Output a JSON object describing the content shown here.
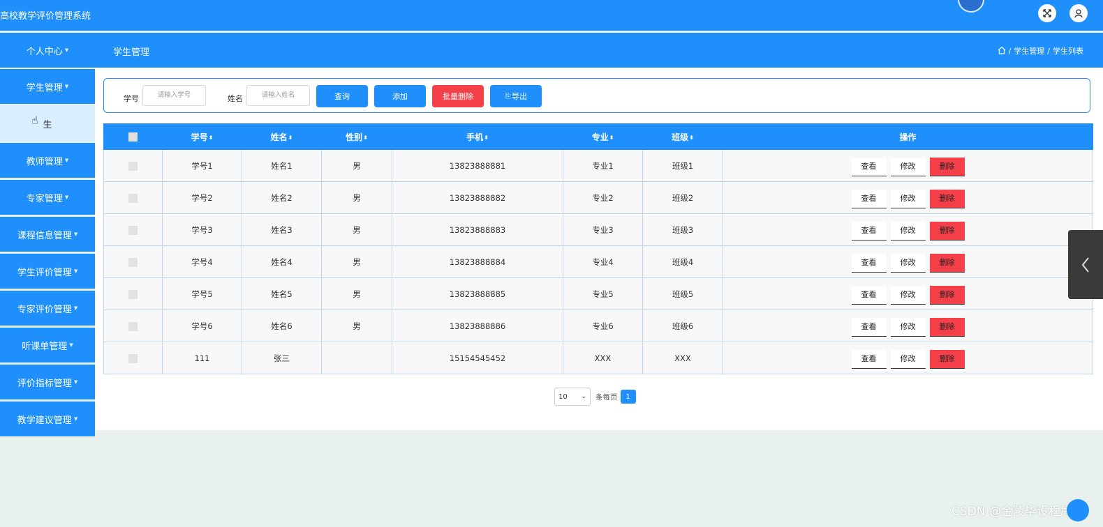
{
  "app": {
    "title": "高校教学评价管理系统"
  },
  "header_icons": [
    "fullscreen-icon",
    "user-icon"
  ],
  "subbar": {
    "title": "学生管理",
    "breadcrumb": [
      "学生管理",
      "学生列表"
    ]
  },
  "sidebar": {
    "items": [
      {
        "label": "个人中心"
      },
      {
        "label": "学生管理"
      },
      {
        "label": "教师管理"
      },
      {
        "label": "专家管理"
      },
      {
        "label": "课程信息管理"
      },
      {
        "label": "学生评价管理"
      },
      {
        "label": "专家评价管理"
      },
      {
        "label": "听课单管理"
      },
      {
        "label": "评价指标管理"
      },
      {
        "label": "教学建议管理"
      }
    ],
    "active_sub": "生"
  },
  "search": {
    "student_no_label": "学号",
    "student_no_placeholder": "请输入学号",
    "name_label": "姓名",
    "name_placeholder": "请输入姓名",
    "query_btn": "查询",
    "add_btn": "添加",
    "batch_delete_btn": "批量删除",
    "export_btn": "导出"
  },
  "table": {
    "columns": [
      "学号",
      "姓名",
      "性别",
      "手机",
      "专业",
      "班级",
      "操作"
    ],
    "rows": [
      {
        "no": "学号1",
        "name": "姓名1",
        "gender": "男",
        "phone": "13823888881",
        "major": "专业1",
        "class": "班级1"
      },
      {
        "no": "学号2",
        "name": "姓名2",
        "gender": "男",
        "phone": "13823888882",
        "major": "专业2",
        "class": "班级2"
      },
      {
        "no": "学号3",
        "name": "姓名3",
        "gender": "男",
        "phone": "13823888883",
        "major": "专业3",
        "class": "班级3"
      },
      {
        "no": "学号4",
        "name": "姓名4",
        "gender": "男",
        "phone": "13823888884",
        "major": "专业4",
        "class": "班级4"
      },
      {
        "no": "学号5",
        "name": "姓名5",
        "gender": "男",
        "phone": "13823888885",
        "major": "专业5",
        "class": "班级5"
      },
      {
        "no": "学号6",
        "name": "姓名6",
        "gender": "男",
        "phone": "13823888886",
        "major": "专业6",
        "class": "班级6"
      },
      {
        "no": "111",
        "name": "张三",
        "gender": "",
        "phone": "15154545452",
        "major": "XXX",
        "class": "XXX"
      }
    ],
    "actions": {
      "view": "查看",
      "edit": "修改",
      "delete": "删除"
    }
  },
  "pagination": {
    "page_size": "10",
    "per_page_label": "条每页",
    "current_page": "1"
  },
  "watermark": "CSDN @金陵毕设程序"
}
